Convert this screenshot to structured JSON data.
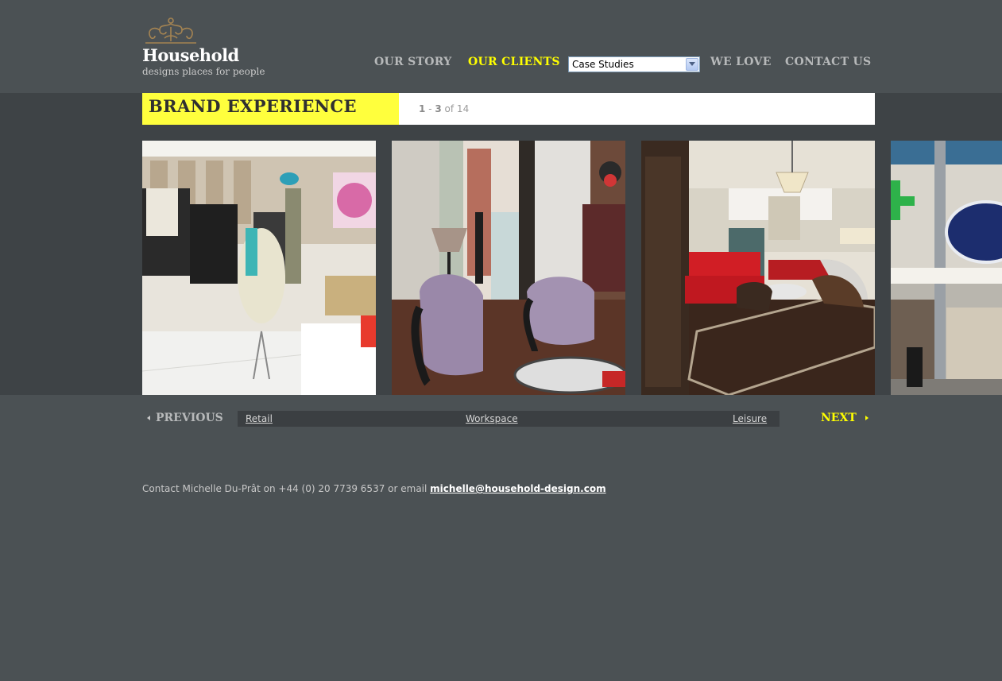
{
  "brand": {
    "name": "Household",
    "tagline": "designs places for people"
  },
  "nav": {
    "our_story": "OUR STORY",
    "our_clients": "OUR CLIENTS",
    "we_love": "WE LOVE",
    "contact_us": "CONTACT US",
    "case_select": "Case Studies"
  },
  "section": {
    "title": "BRAND EXPERIENCE",
    "range_start": "1",
    "range_sep": "-",
    "range_end": "3",
    "of_total": "of 14"
  },
  "photos": [
    {
      "alt": "retail-fashion-store"
    },
    {
      "alt": "boutique-lounge-chairs"
    },
    {
      "alt": "red-sofa-lounge"
    },
    {
      "alt": "pharmacy-storefront"
    }
  ],
  "pager": {
    "previous": "PREVIOUS",
    "next": "NEXT",
    "categories": [
      "Retail",
      "Workspace",
      "Leisure"
    ]
  },
  "footer": {
    "contact_text": "Contact Michelle Du-Prât on +44 (0) 20 7739 6537 or email",
    "email": "michelle@household-design.com"
  },
  "colors": {
    "background": "#4b5154",
    "band": "#3e4346",
    "accent": "#ffff3d",
    "nav_active": "#ffff00"
  }
}
